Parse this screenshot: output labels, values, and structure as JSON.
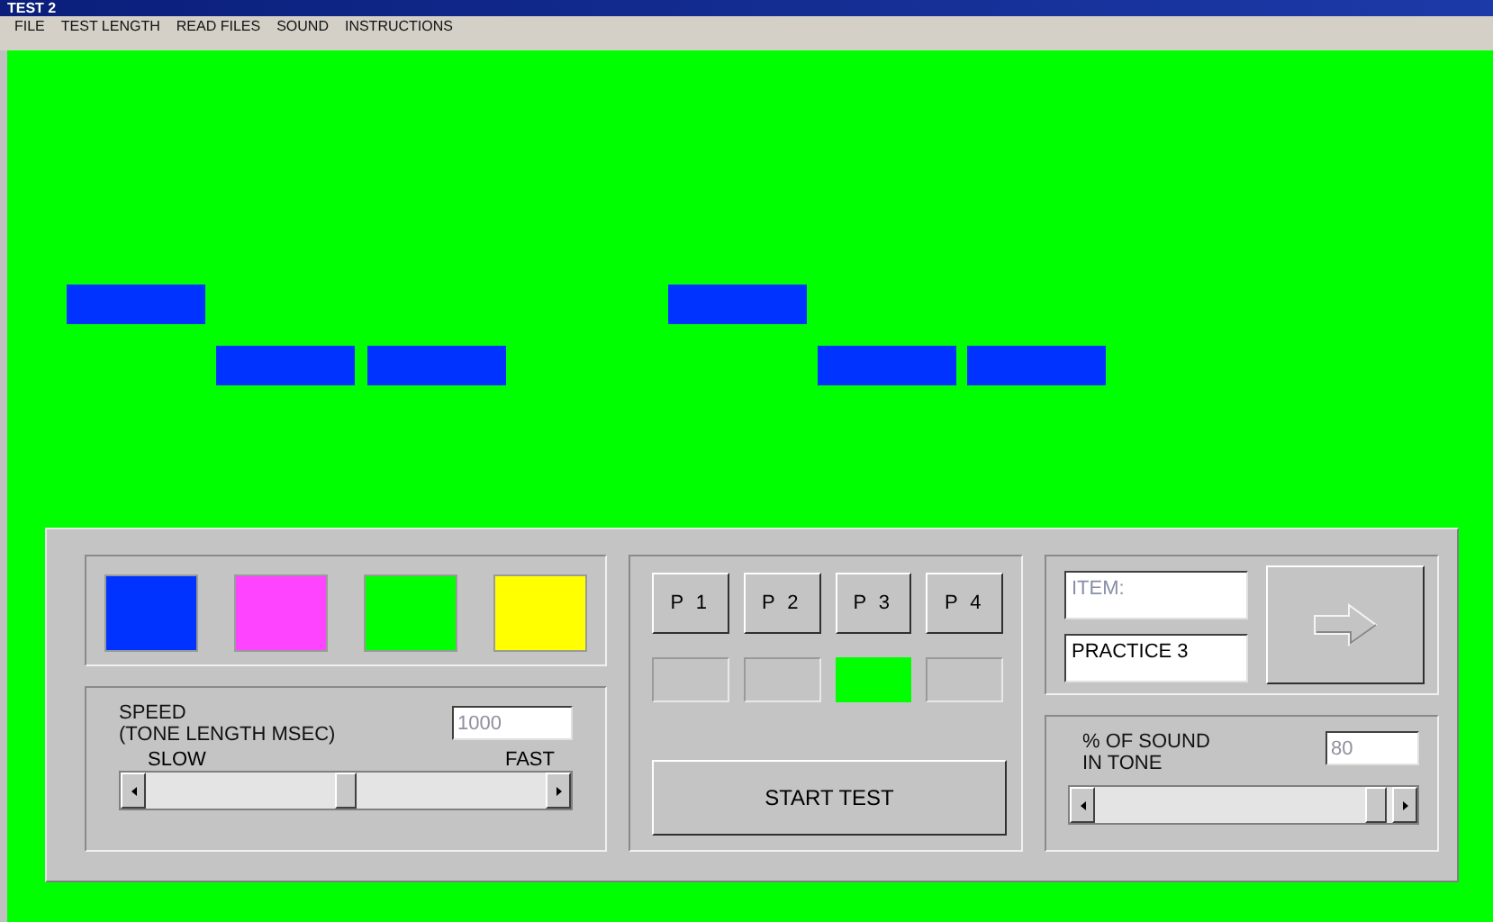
{
  "window": {
    "title": "TEST 2"
  },
  "menu": [
    "FILE",
    "TEST LENGTH",
    "READ FILES",
    "SOUND",
    "INSTRUCTIONS"
  ],
  "pattern": [
    {
      "cells": [
        true,
        false,
        false,
        false,
        true,
        false,
        false
      ]
    },
    {
      "cells": [
        false,
        true,
        true,
        false,
        false,
        true,
        true
      ]
    }
  ],
  "swatches": [
    {
      "color": "#0033ff"
    },
    {
      "color": "#ff44ff"
    },
    {
      "color": "#00ff00"
    },
    {
      "color": "#ffff00"
    }
  ],
  "speed": {
    "label": "SPEED\n(TONE LENGTH MSEC)",
    "value": "1000",
    "disabled": true,
    "min_label": "SLOW",
    "max_label": "FAST"
  },
  "presets": [
    {
      "label": "P 1",
      "lit": false
    },
    {
      "label": "P 2",
      "lit": false
    },
    {
      "label": "P 3",
      "lit": true
    },
    {
      "label": "P 4",
      "lit": false
    }
  ],
  "start_button": "START TEST",
  "item": {
    "placeholder": "ITEM:",
    "value": "PRACTICE 3"
  },
  "sound": {
    "label": "% OF SOUND\nIN TONE",
    "value": "80",
    "disabled": true
  }
}
